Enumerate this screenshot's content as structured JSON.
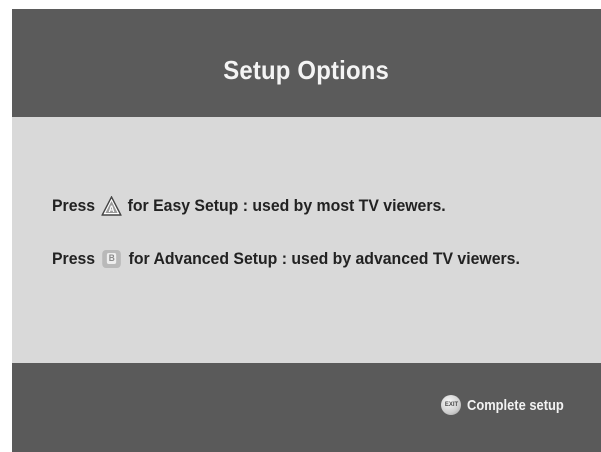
{
  "header": {
    "title": "Setup Options"
  },
  "options": [
    {
      "prefix": "Press",
      "button_icon": "a-button-triangle-icon",
      "button_letter": "A",
      "text": "for Easy Setup : used by most TV viewers."
    },
    {
      "prefix": "Press",
      "button_icon": "b-button-icon",
      "button_letter": "B",
      "text": "for Advanced Setup : used by advanced TV viewers."
    }
  ],
  "footer": {
    "exit_icon": "exit-button-icon",
    "exit_icon_label": "EXIT",
    "complete_label": "Complete setup"
  },
  "colors": {
    "header_bg": "#5b5b5b",
    "content_bg": "#d9d9d9",
    "footer_bg": "#5a5a5a",
    "title_text": "#f4f4f4",
    "body_text": "#222222"
  }
}
